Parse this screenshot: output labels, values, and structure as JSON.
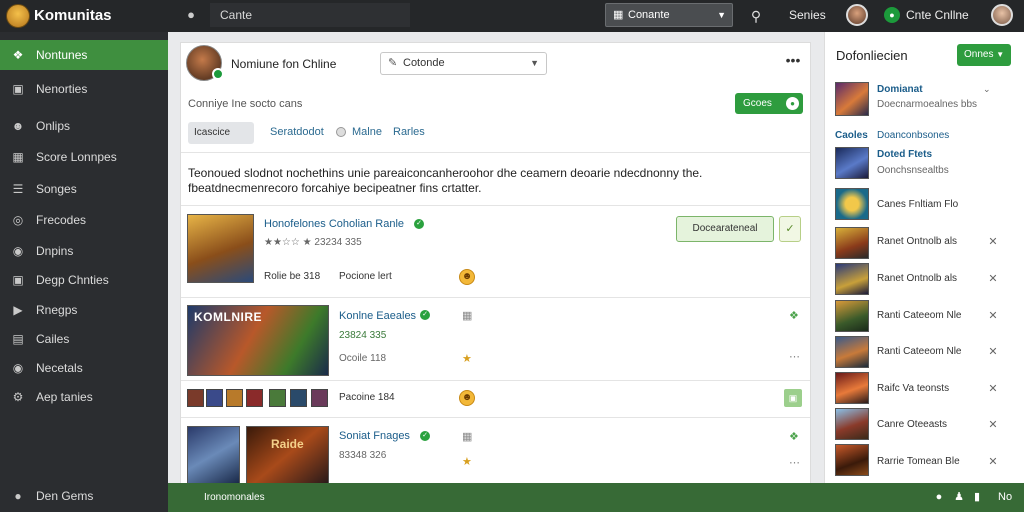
{
  "app": {
    "title": "Komunitas"
  },
  "topbar": {
    "search_placeholder": "Cante",
    "select_value": "Conante",
    "link": "Senies",
    "online_label": "Cnte Cnllne"
  },
  "sidebar": {
    "items": [
      {
        "icon": "puzzle-icon",
        "label": "Nontunes"
      },
      {
        "icon": "monitor-icon",
        "label": "Nenorties"
      },
      {
        "icon": "people-icon",
        "label": "Onlips"
      },
      {
        "icon": "grid-icon",
        "label": "Score Lonnpes"
      },
      {
        "icon": "list-icon",
        "label": "Songes"
      },
      {
        "icon": "compass-icon",
        "label": "Frecodes"
      },
      {
        "icon": "shield-icon",
        "label": "Dnpins"
      },
      {
        "icon": "monitor-icon",
        "label": "Degp Chnties"
      },
      {
        "icon": "chat-icon",
        "label": "Rnegps"
      },
      {
        "icon": "doc-icon",
        "label": "Cailes"
      },
      {
        "icon": "headphones-icon",
        "label": "Necetals"
      },
      {
        "icon": "gear-icon",
        "label": "Aep tanies"
      }
    ],
    "footer": "Den Gems"
  },
  "main": {
    "profile_name": "Nomiune fon Chline",
    "status_select": "Cotonde",
    "subtext": "Conniye Ine socto cans",
    "create_button": "Gcoes",
    "filter_chip": "Icascice",
    "filter_links": [
      "Seratdodot",
      "Malne",
      "Rarles"
    ],
    "description": "Teonoued slodnot nochethins unie pareaiconcanheroohor dhe ceamern deoarie ndecdnonny the. fbeatdnecmenrecoro forcahiye becipeatner fins crtatter."
  },
  "posts": [
    {
      "title": "Honofelones Coholian Ranle",
      "meta": "★★☆☆ ★ 23234 335",
      "footer": "Rolie be 318",
      "footer2": "Pocione lert",
      "action": "Docearateneal"
    },
    {
      "title": "Konlne Eaeales",
      "meta": "23824 335",
      "footer": "Ocoile 118"
    },
    {
      "title": "Soniat Fnages",
      "meta": "83348 326"
    }
  ],
  "post_extras": {
    "banner_text": "KOMLNIRE",
    "poster_text": "Raide",
    "mini_row_label": "Pacoine 184"
  },
  "right_panel": {
    "title": "Dofonliecien",
    "button": "Onnes",
    "featured": {
      "title": "Domianat",
      "sub": "Doecnarmoealnes bbs"
    },
    "section_label": "Caoles",
    "section_sub": "Doanconbsones",
    "second": {
      "title": "Doted Ftets",
      "sub": "Oonchsnsealtbs"
    },
    "items": [
      "Canes Fnltiam Flo",
      "Ranet Ontnolb als",
      "Ranet Ontnolb als",
      "Ranti Cateeom Nle",
      "Ranti Cateeom Nle",
      "Raifc Va teonsts",
      "Canre Oteeasts",
      "Rarrie Tomean Ble"
    ]
  },
  "bottombar": {
    "text": "Ironomonales",
    "label": "No"
  },
  "colors": {
    "accent": "#2e9c3e",
    "sidebar": "#2b2d30",
    "topbar": "#252729",
    "bottombar": "#376a36"
  }
}
